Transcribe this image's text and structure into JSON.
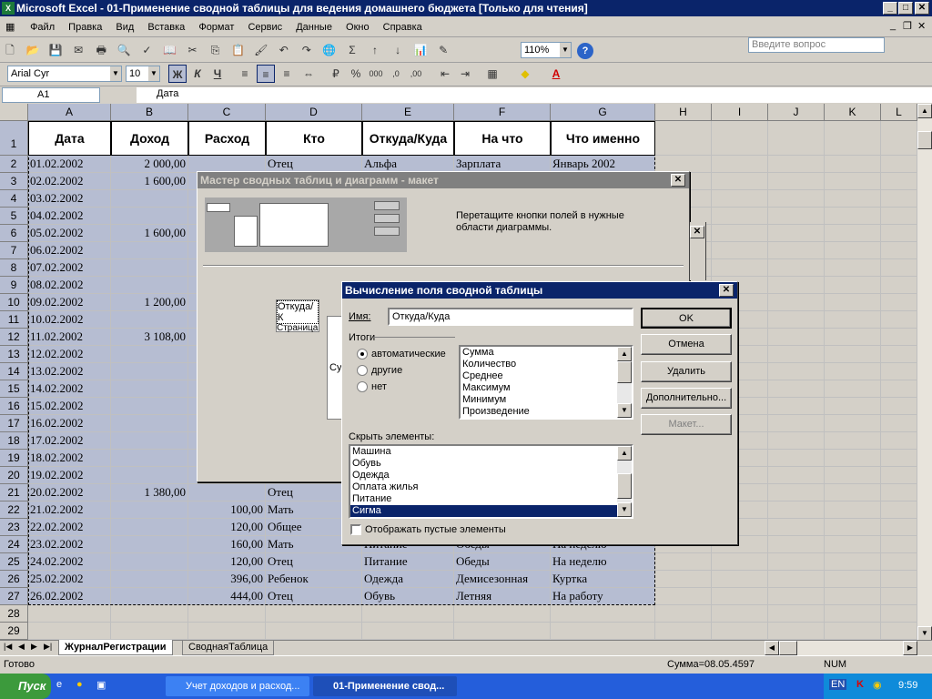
{
  "window": {
    "title": "Microsoft Excel - 01-Применение сводной таблицы для ведения домашнего бюджета  [Только для чтения]"
  },
  "menu": [
    "Файл",
    "Правка",
    "Вид",
    "Вставка",
    "Формат",
    "Сервис",
    "Данные",
    "Окно",
    "Справка"
  ],
  "ask_placeholder": "Введите вопрос",
  "font": {
    "name": "Arial Cyr",
    "size": "10"
  },
  "zoom": "110%",
  "namebox": "A1",
  "formula": "Дата",
  "columns": [
    "A",
    "B",
    "C",
    "D",
    "E",
    "F",
    "G",
    "H",
    "I",
    "J",
    "K",
    "L"
  ],
  "headers": [
    "Дата",
    "Доход",
    "Расход",
    "Кто",
    "Откуда/Куда",
    "На что",
    "Что именно"
  ],
  "rows": [
    {
      "n": "2",
      "a": "01.02.2002",
      "b": "2 000,00",
      "c": "",
      "d": "Отец",
      "e": "Альфа",
      "f": "Зарплата",
      "g": "Январь 2002"
    },
    {
      "n": "3",
      "a": "02.02.2002",
      "b": "1 600,00",
      "c": "",
      "d": "",
      "e": "",
      "f": "",
      "g": ""
    },
    {
      "n": "4",
      "a": "03.02.2002",
      "b": "",
      "c": "",
      "d": "",
      "e": "",
      "f": "",
      "g": ""
    },
    {
      "n": "5",
      "a": "04.02.2002",
      "b": "",
      "c": "",
      "d": "",
      "e": "",
      "f": "",
      "g": ""
    },
    {
      "n": "6",
      "a": "05.02.2002",
      "b": "1 600,00",
      "c": "",
      "d": "",
      "e": "",
      "f": "",
      "g": ""
    },
    {
      "n": "7",
      "a": "06.02.2002",
      "b": "",
      "c": "",
      "d": "",
      "e": "",
      "f": "",
      "g": ""
    },
    {
      "n": "8",
      "a": "07.02.2002",
      "b": "",
      "c": "",
      "d": "",
      "e": "",
      "f": "",
      "g": ""
    },
    {
      "n": "9",
      "a": "08.02.2002",
      "b": "",
      "c": "",
      "d": "",
      "e": "",
      "f": "",
      "g": ""
    },
    {
      "n": "10",
      "a": "09.02.2002",
      "b": "1 200,00",
      "c": "",
      "d": "",
      "e": "",
      "f": "",
      "g": ""
    },
    {
      "n": "11",
      "a": "10.02.2002",
      "b": "",
      "c": "",
      "d": "",
      "e": "",
      "f": "",
      "g": ""
    },
    {
      "n": "12",
      "a": "11.02.2002",
      "b": "3 108,00",
      "c": "",
      "d": "",
      "e": "",
      "f": "",
      "g": ""
    },
    {
      "n": "13",
      "a": "12.02.2002",
      "b": "",
      "c": "",
      "d": "",
      "e": "",
      "f": "",
      "g": ""
    },
    {
      "n": "14",
      "a": "13.02.2002",
      "b": "",
      "c": "",
      "d": "",
      "e": "",
      "f": "",
      "g": ""
    },
    {
      "n": "15",
      "a": "14.02.2002",
      "b": "",
      "c": "",
      "d": "",
      "e": "",
      "f": "",
      "g": ""
    },
    {
      "n": "16",
      "a": "15.02.2002",
      "b": "",
      "c": "",
      "d": "",
      "e": "",
      "f": "",
      "g": ""
    },
    {
      "n": "17",
      "a": "16.02.2002",
      "b": "",
      "c": "",
      "d": "",
      "e": "",
      "f": "",
      "g": ""
    },
    {
      "n": "18",
      "a": "17.02.2002",
      "b": "",
      "c": "",
      "d": "",
      "e": "",
      "f": "",
      "g": ""
    },
    {
      "n": "19",
      "a": "18.02.2002",
      "b": "",
      "c": "",
      "d": "",
      "e": "",
      "f": "",
      "g": ""
    },
    {
      "n": "20",
      "a": "19.02.2002",
      "b": "",
      "c": "",
      "d": "",
      "e": "",
      "f": "",
      "g": ""
    },
    {
      "n": "21",
      "a": "20.02.2002",
      "b": "1 380,00",
      "c": "",
      "d": "Отец",
      "e": "",
      "f": "",
      "g": ""
    },
    {
      "n": "22",
      "a": "21.02.2002",
      "b": "",
      "c": "100,00",
      "d": "Мать",
      "e": "",
      "f": "",
      "g": ""
    },
    {
      "n": "23",
      "a": "22.02.2002",
      "b": "",
      "c": "120,00",
      "d": "Общее",
      "e": "",
      "f": "",
      "g": ""
    },
    {
      "n": "24",
      "a": "23.02.2002",
      "b": "",
      "c": "160,00",
      "d": "Мать",
      "e": "Питание",
      "f": "Обеды",
      "g": "На неделю"
    },
    {
      "n": "25",
      "a": "24.02.2002",
      "b": "",
      "c": "120,00",
      "d": "Отец",
      "e": "Питание",
      "f": "Обеды",
      "g": "На неделю"
    },
    {
      "n": "26",
      "a": "25.02.2002",
      "b": "",
      "c": "396,00",
      "d": "Ребенок",
      "e": "Одежда",
      "f": "Демисезонная",
      "g": "Куртка"
    },
    {
      "n": "27",
      "a": "26.02.2002",
      "b": "",
      "c": "444,00",
      "d": "Отец",
      "e": "Обувь",
      "f": "Летняя",
      "g": "На работу"
    }
  ],
  "empty_rows": [
    "28",
    "29"
  ],
  "wizard": {
    "title": "Мастер сводных таблиц и диаграмм - макет",
    "hint": "Перетащите кнопки полей в нужные области диаграммы.",
    "page_field": "Откуда/К",
    "page_label": "Страница",
    "data_label": "Су"
  },
  "field_dialog": {
    "title": "Вычисление поля сводной таблицы",
    "name_label": "Имя:",
    "name_value": "Откуда/Куда",
    "totals_label": "Итоги",
    "radios": [
      "автоматические",
      "другие",
      "нет"
    ],
    "functions": [
      "Сумма",
      "Количество",
      "Среднее",
      "Максимум",
      "Минимум",
      "Произведение"
    ],
    "hide_label": "Скрыть элементы:",
    "hide_items": [
      "Машина",
      "Обувь",
      "Одежда",
      "Оплата жилья",
      "Питание",
      "Сигма"
    ],
    "show_empty": "Отображать пустые элементы",
    "buttons": {
      "ok": "OK",
      "cancel": "Отмена",
      "delete": "Удалить",
      "advanced": "Дополнительно...",
      "layout": "Макет..."
    }
  },
  "sheets": [
    "ЖурналРегистрации",
    "СводнаяТаблица"
  ],
  "status": {
    "ready": "Готово",
    "sum": "Сумма=08.05.4597",
    "num": "NUM"
  },
  "taskbar": {
    "start": "Пуск",
    "tasks": [
      "Учет доходов и расход...",
      "01-Применение свод..."
    ],
    "lang": "EN",
    "clock": "9:59"
  },
  "colors": {
    "selection": "#b6bdd2",
    "title_active": "#0a246a",
    "taskbar": "#245edb"
  }
}
